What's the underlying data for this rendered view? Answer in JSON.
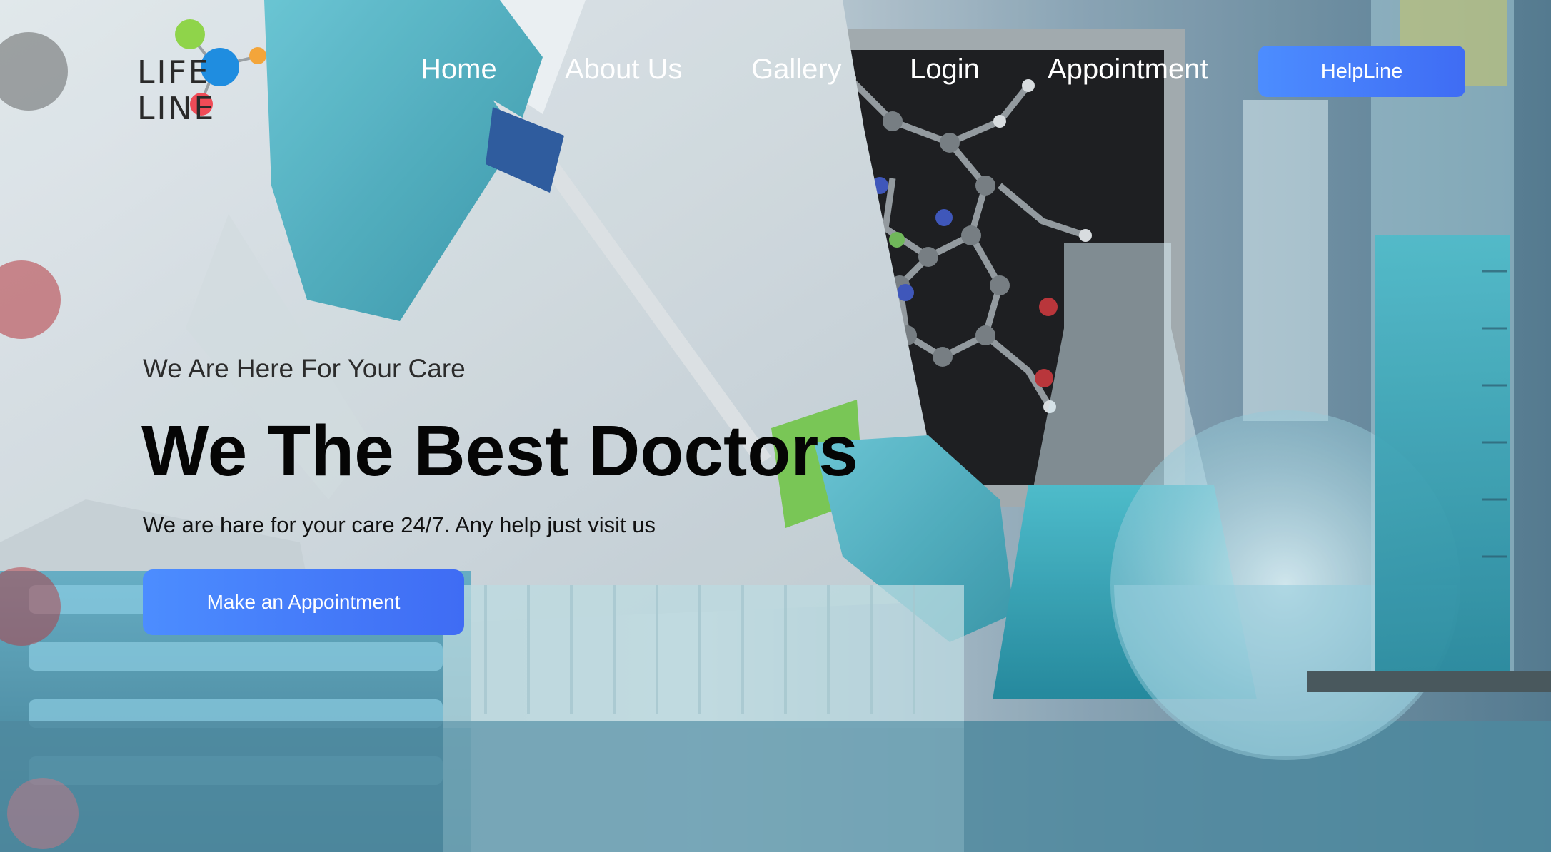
{
  "brand": {
    "logo_text": "LIFE LINE",
    "logo_dot_colors": [
      "#8fd44a",
      "#1f8de0",
      "#f3a53a",
      "#f04b57"
    ]
  },
  "nav": {
    "items": [
      {
        "label": "Home"
      },
      {
        "label": "About Us"
      },
      {
        "label": "Gallery"
      },
      {
        "label": "Login"
      },
      {
        "label": "Appointment"
      }
    ],
    "helpline_label": "HelpLine"
  },
  "hero": {
    "eyebrow": "We Are Here For Your Care",
    "title": "We The Best Doctors",
    "subtitle": "We are hare for your care 24/7. Any help just visit us",
    "cta_label": "Make an Appointment"
  },
  "colors": {
    "accent_start": "#4c8dff",
    "accent_end": "#3f6cf4",
    "nav_text": "#ffffff",
    "title_text": "#050505"
  },
  "background": {
    "icon": "laboratory-photo"
  }
}
